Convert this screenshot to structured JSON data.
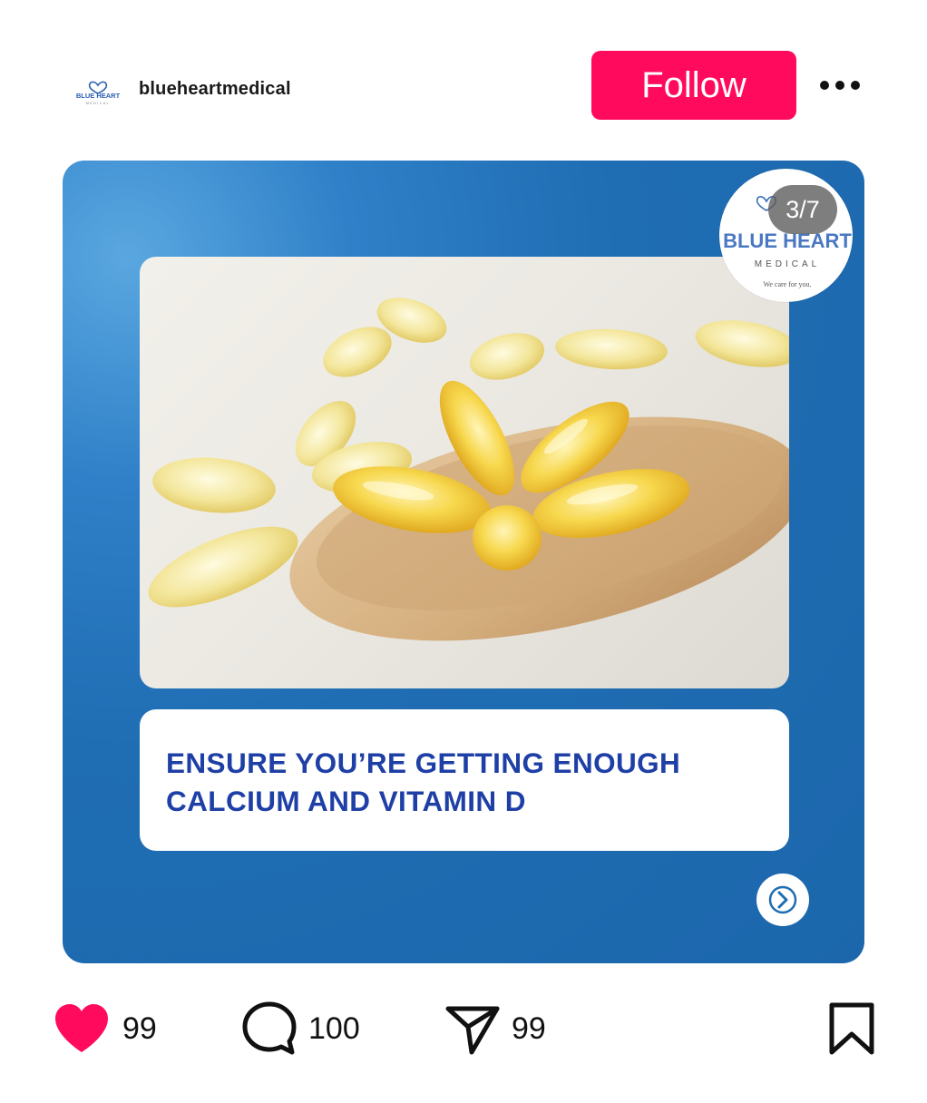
{
  "header": {
    "username": "blueheartmedical",
    "follow_label": "Follow",
    "avatar_text": "BLUE HEART",
    "avatar_subtext": "MEDICAL"
  },
  "post": {
    "counter": "3/7",
    "logo": {
      "title": "BLUE HEART",
      "subtitle": "MEDICAL",
      "tagline": "We care for you."
    },
    "caption_line1": "ENSURE YOU’RE GETTING ENOUGH",
    "caption_line2": "CALCIUM AND VITAMIN D",
    "background_color": "#1f6db3",
    "caption_color": "#1e3fa6"
  },
  "actions": {
    "likes": "99",
    "comments": "100",
    "shares": "99"
  },
  "icons": [
    "heart-icon",
    "comment-icon",
    "send-icon",
    "bookmark-icon",
    "more-icon",
    "chevron-right-icon"
  ],
  "colors": {
    "accent": "#ff0a5c"
  }
}
